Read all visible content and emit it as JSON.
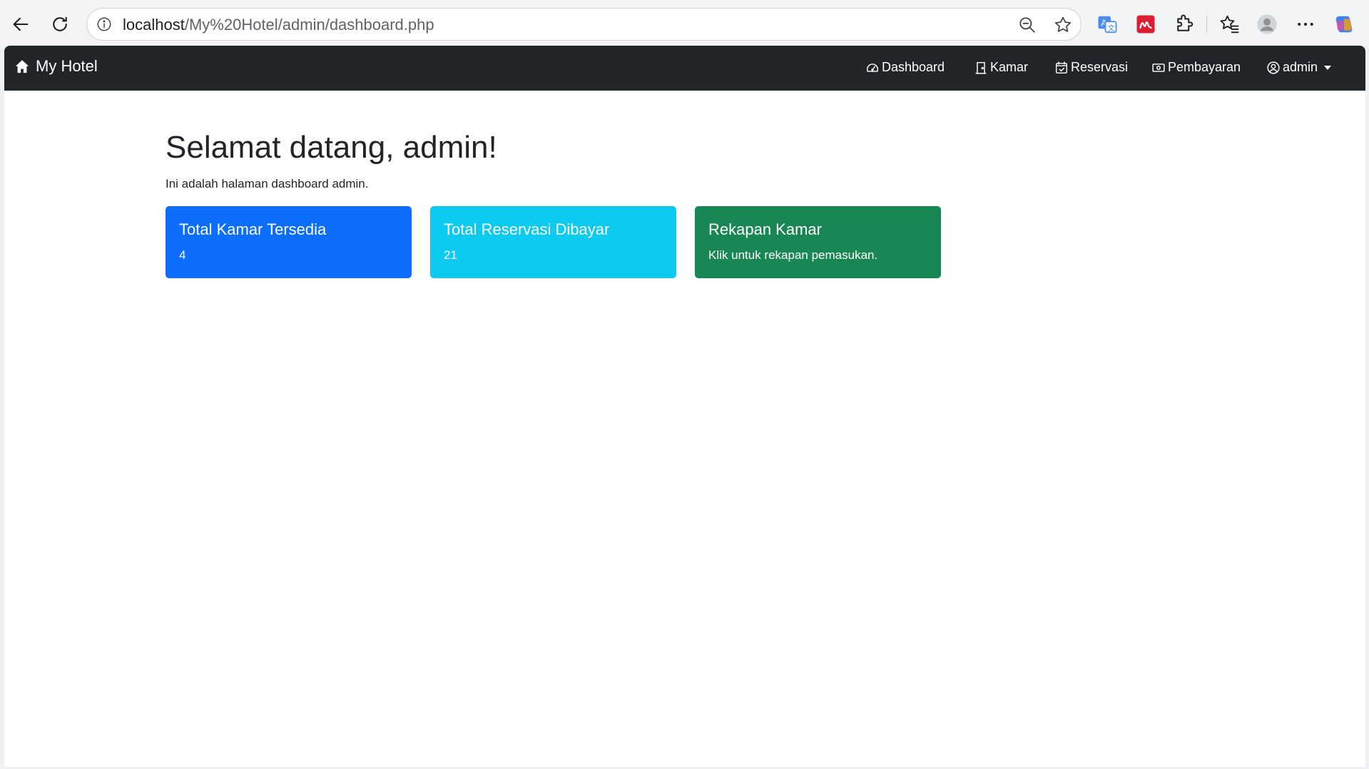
{
  "browser": {
    "url_host": "localhost",
    "url_path": "/My%20Hotel/admin/dashboard.php"
  },
  "navbar": {
    "brand": "My Hotel",
    "links": [
      {
        "label": "Dashboard",
        "icon": "speedometer-icon"
      },
      {
        "label": "Kamar",
        "icon": "door-icon"
      },
      {
        "label": "Reservasi",
        "icon": "calendar-check-icon"
      },
      {
        "label": "Pembayaran",
        "icon": "cash-icon"
      }
    ],
    "user": {
      "label": "admin",
      "icon": "person-circle-icon"
    }
  },
  "main": {
    "title": "Selamat datang, admin!",
    "subtitle": "Ini adalah halaman dashboard admin.",
    "cards": [
      {
        "title": "Total Kamar Tersedia",
        "text": "4",
        "color": "#0d6efd"
      },
      {
        "title": "Total Reservasi Dibayar",
        "text": "21",
        "color": "#0dcaf0"
      },
      {
        "title": "Rekapan Kamar",
        "text": "Klik untuk rekapan pemasukan.",
        "color": "#198754"
      }
    ]
  },
  "colors": {
    "navbar_bg": "#212529",
    "primary": "#0d6efd",
    "info": "#0dcaf0",
    "success": "#198754"
  }
}
